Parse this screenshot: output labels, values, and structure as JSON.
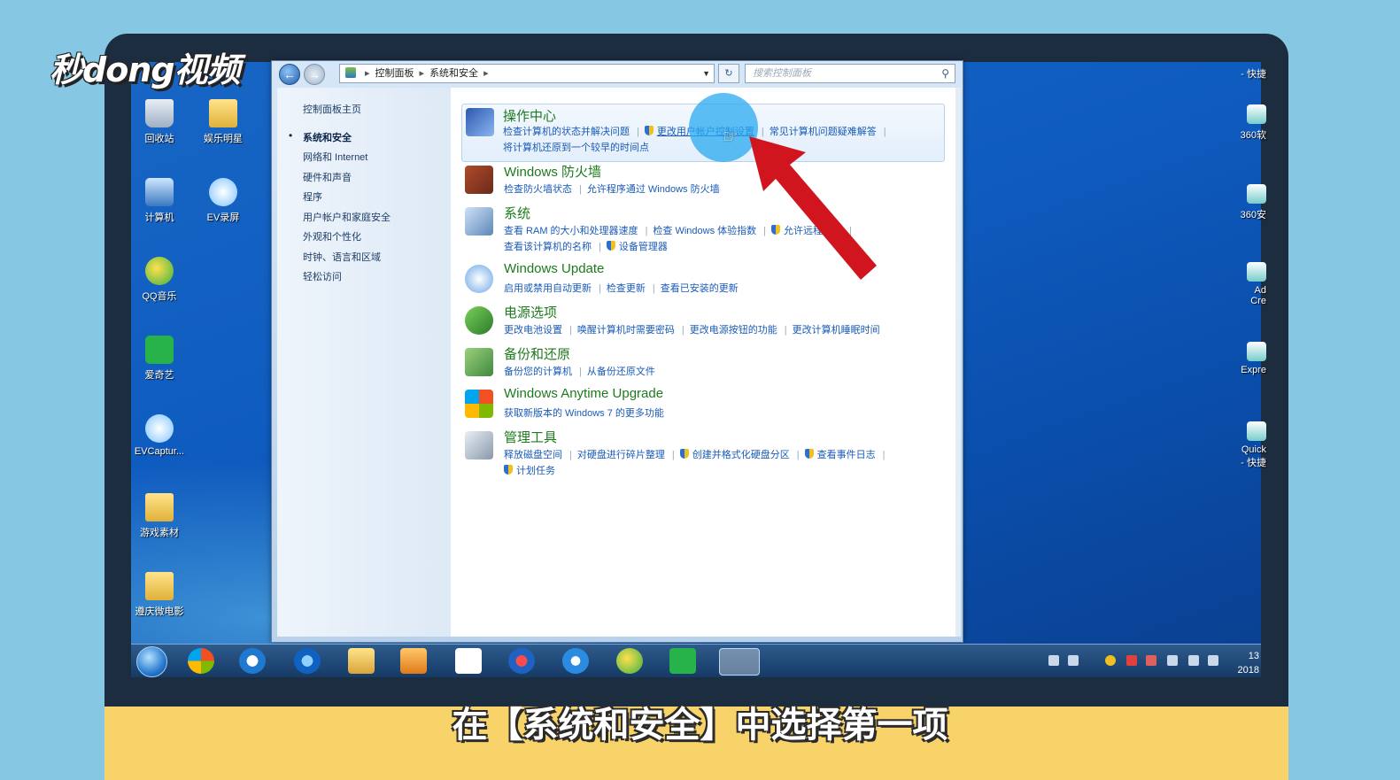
{
  "watermark": {
    "brand": "秒dong视频"
  },
  "caption": "在【系统和安全】中选择第一项",
  "desktop": {
    "left_icons": [
      {
        "label": "回收站",
        "icon": "recycle-bin-icon"
      },
      {
        "label": "娱乐明星",
        "icon": "folder-icon"
      },
      {
        "label": "计算机",
        "icon": "computer-icon"
      },
      {
        "label": "EV录屏",
        "icon": "ev-record-icon"
      },
      {
        "label": "QQ音乐",
        "icon": "qq-music-icon"
      },
      {
        "label": "爱奇艺",
        "icon": "iqiyi-icon"
      },
      {
        "label": "EVCaptur...",
        "icon": "ev-capture-icon"
      },
      {
        "label": "游戏素材",
        "icon": "folder-icon"
      },
      {
        "label": "遵庆微电影",
        "icon": "folder-icon"
      }
    ],
    "right_icons": [
      {
        "label": "- 快捷",
        "icon": "shortcut-icon"
      },
      {
        "label": "360软",
        "icon": "360-software-icon"
      },
      {
        "label": "360安",
        "icon": "360-safe-icon"
      },
      {
        "label": "Ad\nCre",
        "icon": "adobe-icon"
      },
      {
        "label": "Expre",
        "icon": "express-icon"
      },
      {
        "label": "Quick\n- 快捷",
        "icon": "quick-icon"
      }
    ]
  },
  "window": {
    "address": {
      "root": "控制面板",
      "current": "系统和安全"
    },
    "search_placeholder": "搜索控制面板",
    "sidebar": {
      "home": "控制面板主页",
      "items": [
        {
          "label": "系统和安全",
          "selected": true
        },
        {
          "label": "网络和 Internet",
          "selected": false
        },
        {
          "label": "硬件和声音",
          "selected": false
        },
        {
          "label": "程序",
          "selected": false
        },
        {
          "label": "用户帐户和家庭安全",
          "selected": false
        },
        {
          "label": "外观和个性化",
          "selected": false
        },
        {
          "label": "时钟、语言和区域",
          "selected": false
        },
        {
          "label": "轻松访问",
          "selected": false
        }
      ]
    },
    "categories": [
      {
        "title": "操作中心",
        "icon": "action-center-flag-icon",
        "line1": [
          {
            "text": "检查计算机的状态并解决问题"
          },
          {
            "text": "更改用户帐户控制设置",
            "shield": true
          },
          {
            "text": "常见计算机问题疑难解答"
          }
        ],
        "line2": [
          {
            "text": "将计算机还原到一个较早的时间点"
          }
        ]
      },
      {
        "title": "Windows 防火墙",
        "icon": "firewall-icon",
        "line1": [
          {
            "text": "检查防火墙状态"
          },
          {
            "text": "允许程序通过 Windows 防火墙"
          }
        ]
      },
      {
        "title": "系统",
        "icon": "system-icon",
        "line1": [
          {
            "text": "查看 RAM 的大小和处理器速度"
          },
          {
            "text": "检查 Windows 体验指数"
          },
          {
            "text": "允许远程访问",
            "shield": true
          }
        ],
        "line2": [
          {
            "text": "查看该计算机的名称"
          },
          {
            "text": "设备管理器",
            "shield": true
          }
        ]
      },
      {
        "title": "Windows Update",
        "icon": "windows-update-icon",
        "line1": [
          {
            "text": "启用或禁用自动更新"
          },
          {
            "text": "检查更新"
          },
          {
            "text": "查看已安装的更新"
          }
        ]
      },
      {
        "title": "电源选项",
        "icon": "power-options-icon",
        "line1": [
          {
            "text": "更改电池设置"
          },
          {
            "text": "唤醒计算机时需要密码"
          },
          {
            "text": "更改电源按钮的功能"
          },
          {
            "text": "更改计算机睡眠时间"
          }
        ]
      },
      {
        "title": "备份和还原",
        "icon": "backup-restore-icon",
        "line1": [
          {
            "text": "备份您的计算机"
          },
          {
            "text": "从备份还原文件"
          }
        ]
      },
      {
        "title": "Windows Anytime Upgrade",
        "icon": "anytime-upgrade-icon",
        "line1": [
          {
            "text": "获取新版本的 Windows 7 的更多功能"
          }
        ]
      },
      {
        "title": "管理工具",
        "icon": "admin-tools-icon",
        "line1": [
          {
            "text": "释放磁盘空间"
          },
          {
            "text": "对硬盘进行碎片整理"
          },
          {
            "text": "创建并格式化硬盘分区",
            "shield": true
          },
          {
            "text": "查看事件日志",
            "shield": true
          }
        ],
        "line2": [
          {
            "text": "计划任务",
            "shield": true
          }
        ]
      }
    ]
  },
  "taskbar": {
    "apps": [
      "start-orb-icon",
      "360-icon",
      "ie-blue-icon",
      "ie-icon",
      "explorer-icon",
      "media-player-icon",
      "baidu-netdisk-icon",
      "video-player-icon",
      "cloud-icon",
      "qq-music-icon",
      "iqiyi-icon",
      "control-panel-icon"
    ],
    "clock": {
      "time": "13",
      "date": "2018"
    }
  }
}
